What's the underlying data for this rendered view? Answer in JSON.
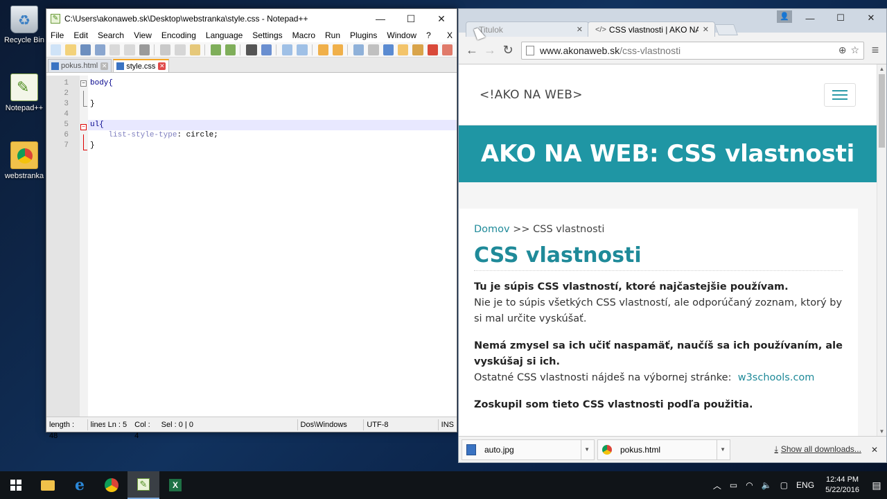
{
  "desktop": {
    "icons": [
      {
        "label": "Recycle Bin",
        "icon": "recycle-bin-icon"
      },
      {
        "label": "Notepad++",
        "icon": "notepadpp-icon"
      },
      {
        "label": "webstranka",
        "icon": "chrome-file-icon"
      }
    ]
  },
  "notepad": {
    "title": "C:\\Users\\akonaweb.sk\\Desktop\\webstranka\\style.css - Notepad++",
    "menu": [
      "File",
      "Edit",
      "Search",
      "View",
      "Encoding",
      "Language",
      "Settings",
      "Macro",
      "Run",
      "Plugins",
      "Window",
      "?"
    ],
    "menu_close": "X",
    "tabs": [
      {
        "label": "pokus.html",
        "active": false
      },
      {
        "label": "style.css",
        "active": true
      }
    ],
    "line_numbers": [
      "1",
      "2",
      "3",
      "4",
      "5",
      "6",
      "7"
    ],
    "code": {
      "l1_sel": "body{",
      "l3": "}",
      "l5_sel": "ul{",
      "l6_prop": "list-style-type",
      "l6_rest": ": circle;",
      "l7": "}"
    },
    "status": {
      "length": "length : 48",
      "lines": "lines",
      "ln": "Ln : 5",
      "col": "Col : 4",
      "sel": "Sel : 0 | 0",
      "eol": "Dos\\Windows",
      "encoding": "UTF-8",
      "mode": "INS"
    }
  },
  "chrome": {
    "tabs": [
      {
        "label": "Titulok",
        "active": false
      },
      {
        "label": "CSS vlastnosti | AKO NA W",
        "active": true
      }
    ],
    "url_domain": "www.akonaweb.sk",
    "url_path": "/css-vlastnosti",
    "site": {
      "logo": "<!AKO NA WEB>",
      "banner": "AKO NA WEB: CSS vlastnosti",
      "breadcrumb_home": "Domov",
      "breadcrumb_sep": ">>",
      "breadcrumb_current": "CSS vlastnosti",
      "heading": "CSS vlastnosti",
      "p1_bold": "Tu je súpis CSS vlastností, ktoré najčastejšie používam.",
      "p1_text": "Nie je to súpis všetkých CSS vlastností, ale odporúčaný zoznam, ktorý by si mal určite vyskúšať.",
      "p2_bold": "Nemá zmysel sa ich učiť naspamäť, naučíš sa ich používaním, ale vyskúšaj si ich.",
      "p2_text": "Ostatné CSS vlastnosti nájdeš na výbornej stránke:",
      "p2_link": "w3schools.com",
      "p3_bold": "Zoskupil som tieto CSS vlastnosti podľa použitia."
    },
    "downloads": [
      {
        "name": "auto.jpg"
      },
      {
        "name": "pokus.html"
      }
    ],
    "show_all": "Show all downloads..."
  },
  "taskbar": {
    "lang": "ENG",
    "time": "12:44 PM",
    "date": "5/22/2016"
  }
}
